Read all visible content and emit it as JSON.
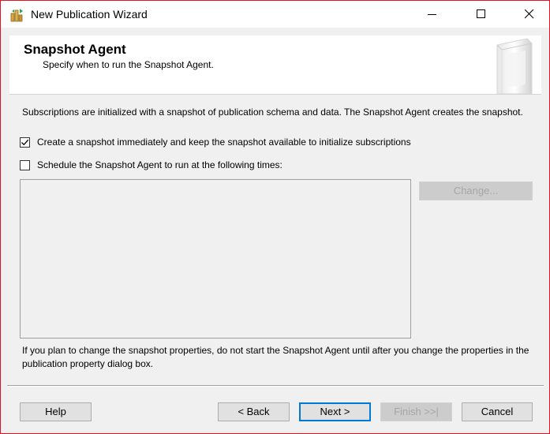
{
  "window": {
    "title": "New Publication Wizard"
  },
  "header": {
    "title": "Snapshot Agent",
    "subtitle": "Specify when to run the Snapshot Agent."
  },
  "main": {
    "description": "Subscriptions are initialized with a snapshot of publication schema and data. The Snapshot Agent creates the snapshot.",
    "options": [
      {
        "label": "Create a snapshot immediately and keep the snapshot available to initialize subscriptions",
        "checked": true
      },
      {
        "label": "Schedule the Snapshot Agent to run at the following times:",
        "checked": false
      }
    ],
    "change_button": "Change...",
    "note": "If you plan to change the snapshot properties, do not start the Snapshot Agent until after you change the properties in the publication property dialog box."
  },
  "footer": {
    "help": "Help",
    "back": "< Back",
    "next": "Next >",
    "finish": "Finish >>|",
    "cancel": "Cancel"
  },
  "colors": {
    "accent": "#0078d7",
    "window_border": "#e81123",
    "dialog_bg": "#f0f0f0"
  },
  "icons": {
    "app": "publication-wizard-icon",
    "minimize": "minimize-icon",
    "maximize": "maximize-icon",
    "close": "close-icon",
    "header": "snapshot-glass-icon",
    "check": "checkmark-icon"
  }
}
